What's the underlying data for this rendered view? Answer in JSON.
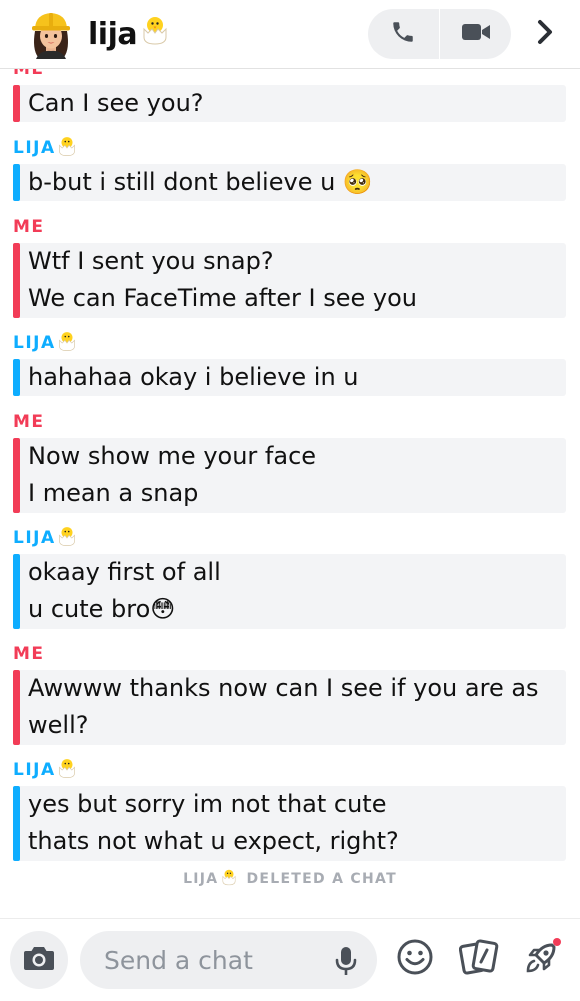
{
  "header": {
    "contact_name": "lija",
    "avatar_icon": "bitmoji-hardhat-avatar",
    "call_icon": "phone-icon",
    "video_icon": "video-camera-icon",
    "more_icon": "chevron-right-icon"
  },
  "messages": [
    {
      "sender": "ME",
      "type": "me",
      "lines": [
        "Can I see you?"
      ]
    },
    {
      "sender": "LIJA",
      "type": "lija",
      "lines": [
        "b-but i still dont believe u 🥺"
      ]
    },
    {
      "sender": "ME",
      "type": "me",
      "lines": [
        "Wtf I sent you snap?",
        "We can FaceTime after I see you"
      ]
    },
    {
      "sender": "LIJA",
      "type": "lija",
      "lines": [
        "hahahaa okay i believe in u"
      ]
    },
    {
      "sender": "ME",
      "type": "me",
      "lines": [
        "Now show me your face",
        "I mean a snap"
      ]
    },
    {
      "sender": "LIJA",
      "type": "lija",
      "lines": [
        "okaay first of all",
        "u cute bro😳"
      ]
    },
    {
      "sender": "ME",
      "type": "me",
      "lines": [
        "Awwww thanks now can I see if you are as",
        "well?"
      ]
    },
    {
      "sender": "LIJA",
      "type": "lija",
      "lines": [
        "yes but sorry im not that cute",
        "thats not what u expect, right?"
      ]
    }
  ],
  "deleted_notice": {
    "name": "LIJA",
    "text": "DELETED A CHAT"
  },
  "composer": {
    "placeholder": "Send a chat",
    "camera_icon": "camera-icon",
    "mic_icon": "microphone-icon",
    "emoji_icon": "smiley-icon",
    "cards_icon": "cards-icon",
    "rocket_icon": "rocket-icon"
  },
  "colors": {
    "me": "#f23c57",
    "lija": "#0eadff",
    "bubble_bg": "#f3f4f6"
  }
}
